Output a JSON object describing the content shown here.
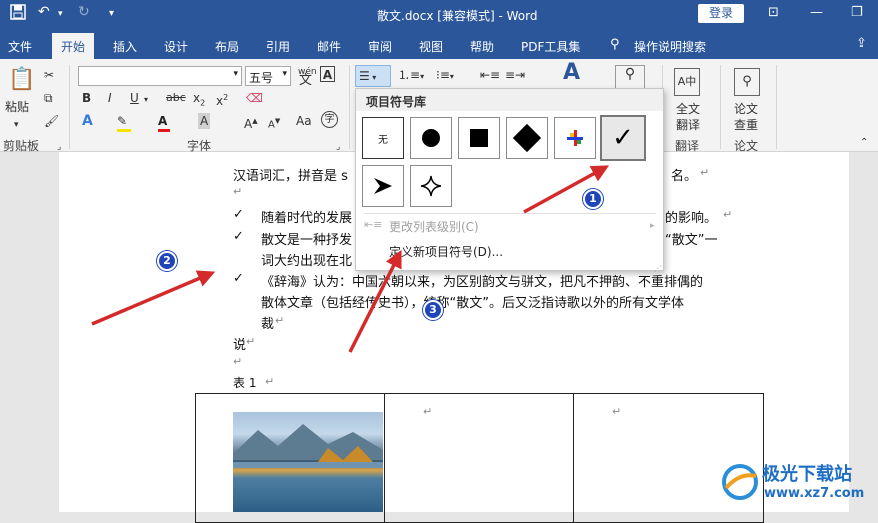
{
  "titlebar": {
    "title": "散文.docx [兼容模式] - Word",
    "login": "登录"
  },
  "tabs": [
    "文件",
    "开始",
    "插入",
    "设计",
    "布局",
    "引用",
    "邮件",
    "审阅",
    "视图",
    "帮助",
    "PDF工具集"
  ],
  "tell_me": "操作说明搜索",
  "ribbon": {
    "paste": "粘贴",
    "clipboard": "剪贴板",
    "font_group": "字体",
    "font_size": "五号",
    "wen": "wén",
    "translate_full": "全文",
    "translate_full2": "翻译",
    "translate_group": "翻译",
    "paper_check": "论文",
    "paper_check2": "查重",
    "paper_group": "论文"
  },
  "dropdown": {
    "header": "项目符号库",
    "none_label": "无",
    "change_level": "更改列表级别(C)",
    "define_new": "定义新项目符号(D)..."
  },
  "doc": {
    "line1": "汉语词汇，拼音是 s",
    "line1_end": "名。",
    "item1_start": "随着时代的发展",
    "item1_end": "的影响。",
    "item2_start": "散文是一种抒发",
    "item2_end": "“散文”一",
    "item2_line2": "词大约出现在北",
    "item3_line1": "《辞海》认为：中国六朝以来，为区别韵文与骈文，把凡不押韵、不重排偶的",
    "item3_line2": "散体文章（包括经传史书），统称“散文”。后又泛指诗歌以外的所有文学体",
    "item3_line3": "裁",
    "shuo": "说",
    "table_caption": "表 1",
    "check": "✓",
    "ret": "↵"
  },
  "badges": [
    "1",
    "2",
    "3"
  ],
  "watermark": {
    "cn": "极光下载站",
    "url": "www.xz7.com"
  },
  "colors": {
    "word_blue": "#2b579a",
    "arrow_red": "#d42a2a",
    "badge_blue": "#1f45b8"
  }
}
